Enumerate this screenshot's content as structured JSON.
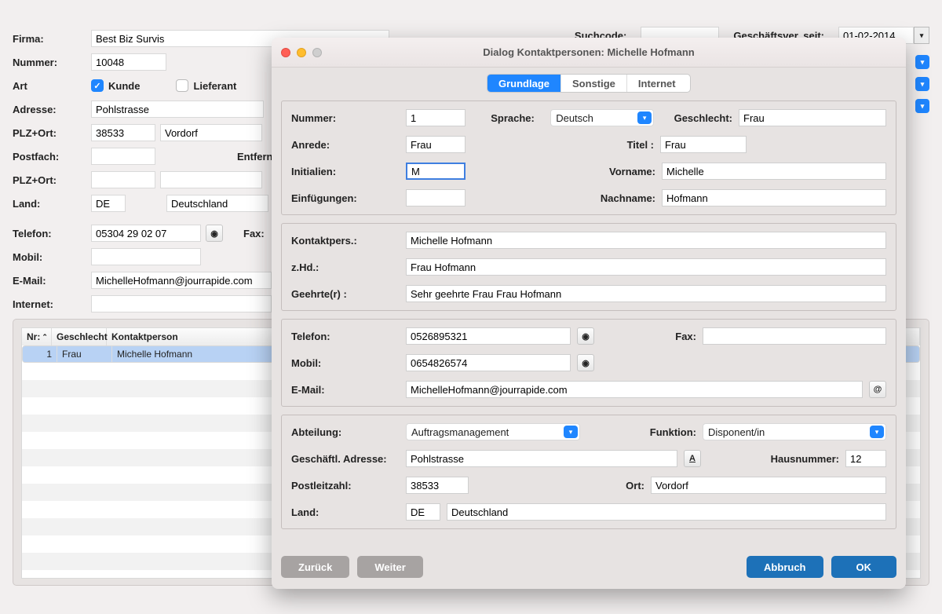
{
  "bg": {
    "labels": {
      "firma": "Firma:",
      "nummer": "Nummer:",
      "art": "Art",
      "kunde": "Kunde",
      "lieferant": "Lieferant",
      "adresse": "Adresse:",
      "plzort": "PLZ+Ort:",
      "postfach": "Postfach:",
      "entfern": "Entfern",
      "plzort2": "PLZ+Ort:",
      "land": "Land:",
      "telefon": "Telefon:",
      "fax": "Fax:",
      "mobil": "Mobil:",
      "email": "E-Mail:",
      "internet": "Internet:",
      "suchcode": "Suchcode:",
      "geseit": "Geschäftsver. seit:"
    },
    "values": {
      "firma": "Best Biz Survis",
      "nummer": "10048",
      "adresse": "Pohlstrasse",
      "plz": "38533",
      "ort": "Vordorf",
      "land_code": "DE",
      "land_name": "Deutschland",
      "telefon": "05304 29 02 07",
      "email": "MichelleHofmann@jourrapide.com",
      "geseit": "01-02-2014"
    },
    "table": {
      "cols": {
        "nr": "Nr:",
        "up": "⌃",
        "geschlecht": "Geschlecht",
        "kontakt": "Kontaktperson"
      },
      "row": {
        "nr": "1",
        "geschlecht": "Frau",
        "kontakt": "Michelle Hofmann"
      }
    }
  },
  "dlg": {
    "title": "Dialog Kontaktpersonen: Michelle Hofmann",
    "tabs": {
      "g": "Grundlage",
      "s": "Sonstige",
      "i": "Internet"
    },
    "g1": {
      "nummer_l": "Nummer:",
      "nummer_v": "1",
      "sprache_l": "Sprache:",
      "sprache_v": "Deutsch",
      "geschlecht_l": "Geschlecht:",
      "geschlecht_v": "Frau",
      "anrede_l": "Anrede:",
      "anrede_v": "Frau",
      "titel_l": "Titel :",
      "titel_v": "Frau",
      "initialien_l": "Initialien:",
      "initialien_v": "M",
      "vorname_l": "Vorname:",
      "vorname_v": "Michelle",
      "einfug_l": "Einfügungen:",
      "einfug_v": "",
      "nachname_l": "Nachname:",
      "nachname_v": "Hofmann"
    },
    "g2": {
      "kontakt_l": "Kontaktpers.:",
      "kontakt_v": "Michelle Hofmann",
      "zhd_l": "z.Hd.:",
      "zhd_v": "Frau Hofmann",
      "geehrte_l": "Geehrte(r) :",
      "geehrte_v": "Sehr geehrte Frau Frau Hofmann"
    },
    "g3": {
      "tel_l": "Telefon:",
      "tel_v": "0526895321",
      "fax_l": "Fax:",
      "fax_v": "",
      "mobil_l": "Mobil:",
      "mobil_v": "0654826574",
      "email_l": "E-Mail:",
      "email_v": "MichelleHofmann@jourrapide.com"
    },
    "g4": {
      "abteilung_l": "Abteilung:",
      "abteilung_v": "Auftragsmanagement",
      "funktion_l": "Funktion:",
      "funktion_v": "Disponent/in",
      "gadr_l": "Geschäftl. Adresse:",
      "gadr_v": "Pohlstrasse",
      "hausnr_l": "Hausnummer:",
      "hausnr_v": "12",
      "plz_l": "Postleitzahl:",
      "plz_v": "38533",
      "ort_l": "Ort:",
      "ort_v": "Vordorf",
      "land_l": "Land:",
      "land_code": "DE",
      "land_name": "Deutschland"
    },
    "btns": {
      "zuruck": "Zurück",
      "weiter": "Weiter",
      "abbruch": "Abbruch",
      "ok": "OK"
    }
  }
}
